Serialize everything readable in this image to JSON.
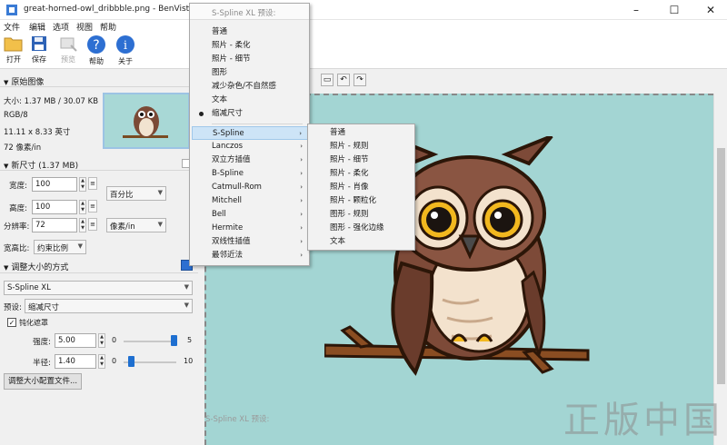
{
  "window": {
    "title": "great-horned-owl_dribbble.png - BenVista Pho",
    "minimize": "–",
    "maximize": "☐",
    "close": "✕"
  },
  "menubar": [
    "文件",
    "编辑",
    "选项",
    "视图",
    "帮助"
  ],
  "toolbar": {
    "open": "打开",
    "save": "保存",
    "preview": "预览",
    "help": "帮助",
    "about": "关于"
  },
  "original_image": {
    "header": "原始图像",
    "size": "大小: 1.37 MB / 30.07 KB",
    "mode": "RGB/8",
    "dimensions": "11.11 x 8.33 英寸",
    "resolution": "72 像素/in"
  },
  "new_size": {
    "header": "新尺寸 (1.37 MB)",
    "width_label": "宽度:",
    "width_value": "100",
    "height_label": "高度:",
    "height_value": "100",
    "resolution_label": "分辨率:",
    "resolution_value": "72",
    "unit": "百分比",
    "res_unit": "像素/in",
    "aspect_label": "宽高比:",
    "aspect_value": "约束比例"
  },
  "resize_method": {
    "header": "调整大小的方式",
    "method": "S-Spline XL",
    "preset_label": "预设:",
    "preset_value": "缩减尺寸",
    "sharpen_label": "钝化遮罩",
    "sharpen_checked": true,
    "strength_label": "强度:",
    "strength_value": "5.00",
    "strength_min": "0",
    "strength_max": "5",
    "strength_level": 0.95,
    "radius_label": "半径:",
    "radius_value": "1.40",
    "radius_min": "0",
    "radius_max": "10",
    "radius_level": 0.14,
    "config_button": "调整大小配置文件..."
  },
  "preset_menu": {
    "header": "S-Spline XL 预设:",
    "items": [
      "普通",
      "照片 - 柔化",
      "照片 - 细节",
      "图形",
      "减少杂色/不自然感",
      "文本",
      "缩减尺寸"
    ],
    "selected": "缩减尺寸",
    "footer_header": "S-Spline XL 预设:"
  },
  "method_menu": {
    "items": [
      "S-Spline",
      "Lanczos",
      "双立方插值",
      "B-Spline",
      "Catmull-Rom",
      "Mitchell",
      "Bell",
      "Hermite",
      "双线性插值",
      "最邻近法"
    ],
    "highlighted": "S-Spline"
  },
  "spline_submenu": {
    "items": [
      "普通",
      "照片 - 规则",
      "照片 - 细节",
      "照片 - 柔化",
      "照片 - 肖像",
      "照片 - 颗粒化",
      "图形 - 规则",
      "图形 - 强化边缘",
      "文本"
    ]
  },
  "watermark": "正版中国",
  "colors": {
    "canvas_bg": "#a3d5d3",
    "accent": "#1e6fd0",
    "menu_highlight": "#cde4f7"
  }
}
